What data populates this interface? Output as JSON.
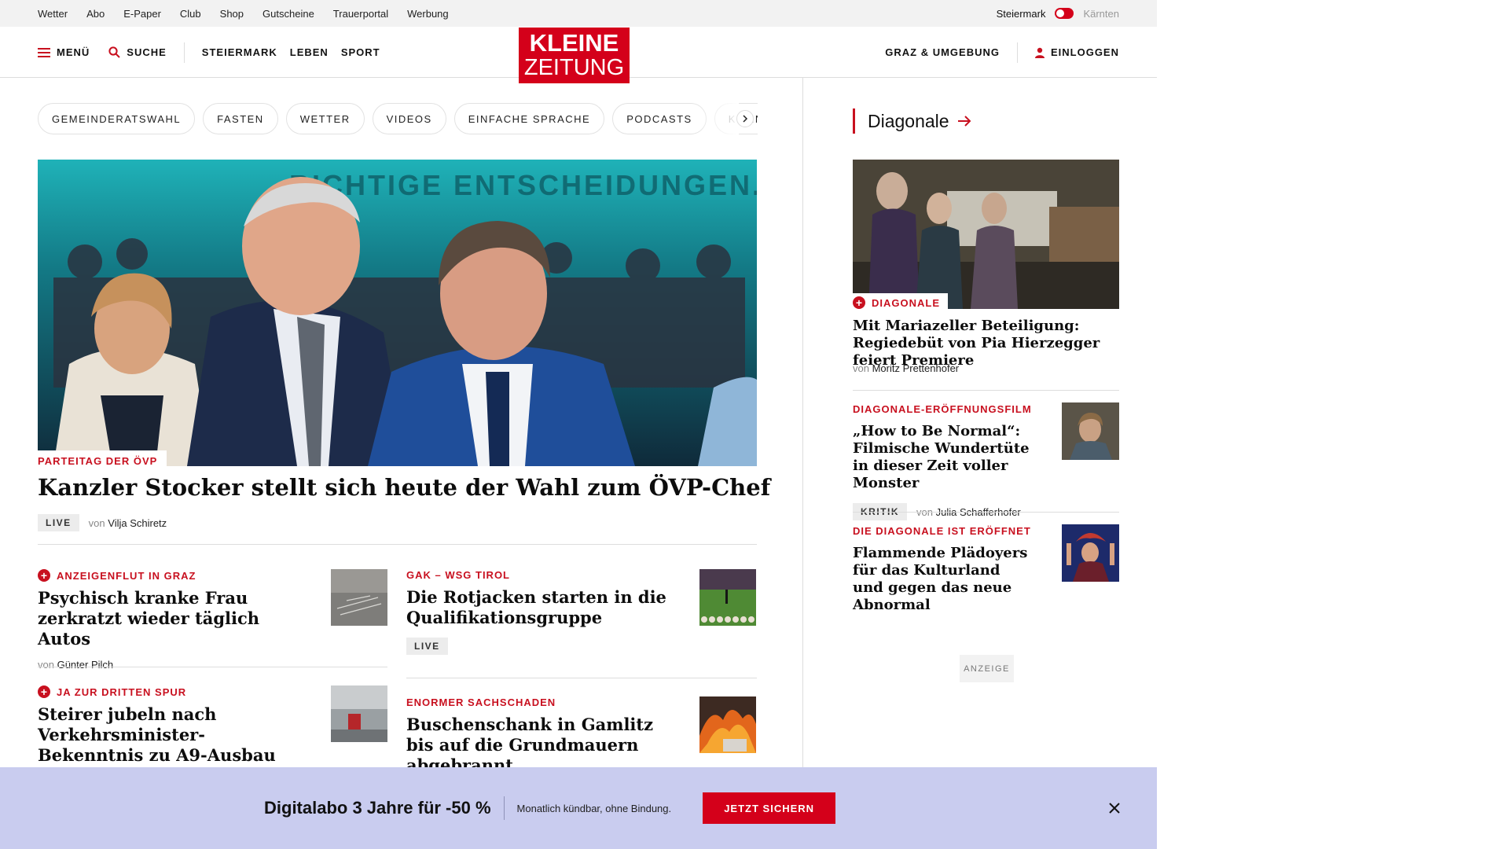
{
  "utility": {
    "links": [
      "Wetter",
      "Abo",
      "E-Paper",
      "Club",
      "Shop",
      "Gutscheine",
      "Trauerportal",
      "Werbung"
    ],
    "region_active": "Steiermark",
    "region_inactive": "Kärnten"
  },
  "header": {
    "menu_label": "MENÜ",
    "search_label": "SUCHE",
    "nav": [
      "STEIERMARK",
      "LEBEN",
      "SPORT"
    ],
    "logo_line1": "KLEINE",
    "logo_line2": "ZEITUNG",
    "local_label": "GRAZ & UMGEBUNG",
    "login_label": "EINLOGGEN"
  },
  "chips": [
    "GEMEINDERATSWAHL",
    "FASTEN",
    "WETTER",
    "VIDEOS",
    "EINFACHE SPRACHE",
    "PODCASTS",
    "KLEINE KINDER"
  ],
  "hero": {
    "image_banner_text": "RICHTIGE ENTSCHEIDUNGEN.",
    "roofline": "PARTEITAG DER ÖVP",
    "title": "Kanzler Stocker stellt sich heute der Wahl zum ÖVP-Chef",
    "badge": "LIVE",
    "von": "von",
    "author": "Vilja Schiretz"
  },
  "teasers": [
    {
      "roofline": "ANZEIGENFLUT IN GRAZ",
      "title": "Psychisch kranke Frau zerkratzt wieder täglich Autos",
      "von": "von",
      "author": "Günter Pilch"
    },
    {
      "roofline": "GAK – WSG TIROL",
      "title": "Die Rotjacken starten in die Qualifikationsgruppe",
      "badge": "LIVE"
    },
    {
      "roofline": "JA ZUR DRITTEN SPUR",
      "title": "Steirer jubeln nach Verkehrsminister-Bekenntnis zu A9-Ausbau"
    },
    {
      "roofline": "ENORMER SACHSCHADEN",
      "title": "Buschenschank in Gamlitz bis auf die Grundmauern abgebrannt"
    }
  ],
  "sidebar": {
    "section_title": "Diagonale",
    "top": {
      "roofline": "DIAGONALE",
      "title": "Mit Mariazeller Beteiligung: Regiedebüt von Pia Hierzegger feiert Premiere",
      "von": "von",
      "author": "Moritz Prettenhofer"
    },
    "items": [
      {
        "roofline": "DIAGONALE-ERÖFFNUNGSFILM",
        "title": "„How to Be Normal“: Filmische Wundertüte in dieser Zeit voller Monster",
        "badge": "KRITIK",
        "von": "von",
        "author": "Julia Schafferhofer"
      },
      {
        "roofline": "DIE DIAGONALE IST ERÖFFNET",
        "title": "Flammende Plädoyers für das Kulturland und gegen das neue Abnormal"
      }
    ],
    "ad_label": "ANZEIGE"
  },
  "promo": {
    "title": "Digitalabo 3 Jahre für -50 %",
    "subtitle": "Monatlich kündbar, ohne Bindung.",
    "cta": "JETZT SICHERN"
  },
  "colors": {
    "brand_red": "#d4001a",
    "roofline_red": "#c8101f",
    "promo_bg": "#c9ccef"
  }
}
